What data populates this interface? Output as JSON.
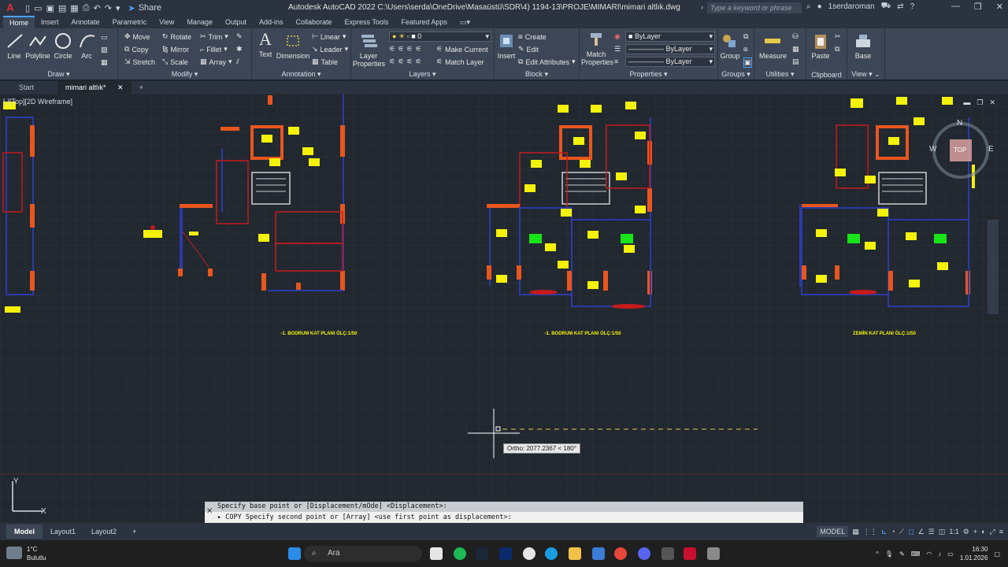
{
  "titlebar": {
    "app_title": "Autodesk AutoCAD 2022   C:\\Users\\serda\\OneDrive\\Masaüstü\\SDR\\4) 1194-13\\PROJE\\MIMARI\\mimari altlık.dwg",
    "share_label": "Share",
    "search_placeholder": "Type a keyword or phrase",
    "user_name": "1serdaroman"
  },
  "ribbon_tabs": [
    "Home",
    "Insert",
    "Annotate",
    "Parametric",
    "View",
    "Manage",
    "Output",
    "Add-ins",
    "Collaborate",
    "Express Tools",
    "Featured Apps"
  ],
  "ribbon": {
    "draw": {
      "title": "Draw",
      "line": "Line",
      "polyline": "Polyline",
      "circle": "Circle",
      "arc": "Arc"
    },
    "modify": {
      "title": "Modify",
      "move": "Move",
      "rotate": "Rotate",
      "trim": "Trim",
      "copy": "Copy",
      "mirror": "Mirror",
      "fillet": "Fillet",
      "stretch": "Stretch",
      "scale": "Scale",
      "array": "Array"
    },
    "annotation": {
      "title": "Annotation",
      "text": "Text",
      "dimension": "Dimension",
      "linear": "Linear",
      "leader": "Leader",
      "table": "Table"
    },
    "layers": {
      "title": "Layers",
      "layer_properties": "Layer Properties",
      "current_layer": "0",
      "make_current": "Make Current",
      "match_layer": "Match Layer"
    },
    "block": {
      "title": "Block",
      "insert": "Insert",
      "create": "Create",
      "edit": "Edit",
      "edit_attributes": "Edit Attributes"
    },
    "properties": {
      "title": "Properties",
      "match_properties": "Match Properties",
      "color": "ByLayer",
      "linetype": "ByLayer",
      "lineweight": "ByLayer"
    },
    "groups": {
      "title": "Groups",
      "group": "Group"
    },
    "utilities": {
      "title": "Utilities",
      "measure": "Measure"
    },
    "clipboard": {
      "title": "Clipboard",
      "paste": "Paste"
    },
    "view": {
      "title": "View",
      "base": "Base"
    }
  },
  "file_tabs": {
    "start": "Start",
    "drawing": "mimari altlık*"
  },
  "viewport_label": "[-][Top][2D Wireframe]",
  "viewcube": {
    "top": "TOP",
    "north": "N",
    "south": "S",
    "east": "E",
    "west": "W"
  },
  "plans": [
    {
      "label": "-1. BODRUM KAT PLANI ÖLÇ:1/50"
    },
    {
      "label": "-1. BODRUM KAT PLANI ÖLÇ:1/50"
    },
    {
      "label": "ZEMİN KAT PLANI ÖLÇ:1/50"
    }
  ],
  "cursor_tooltip": "Ortho: 2077.2367 < 180°",
  "command": {
    "history": "Specify base point or [Displacement/mOde] <Displacement>:",
    "prompt": "COPY Specify second point or [Array] <use first point as displacement>:"
  },
  "layout_tabs": [
    "Model",
    "Layout1",
    "Layout2"
  ],
  "status": {
    "mode": "MODEL",
    "scale": "1:1"
  },
  "taskbar": {
    "weather_temp": "1°C",
    "weather_desc": "Bulutlu",
    "search_label": "Ara",
    "time": "16:30",
    "date": "1.01.2026"
  }
}
